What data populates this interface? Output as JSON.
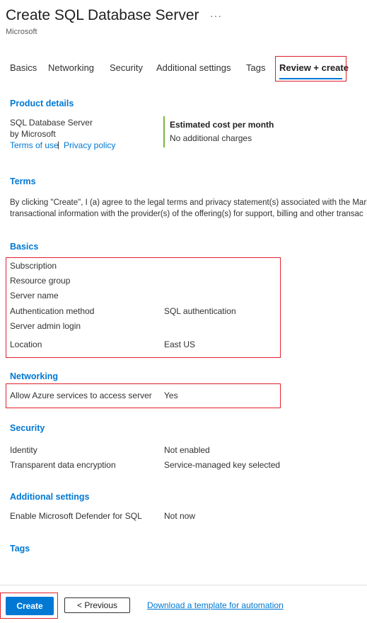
{
  "header": {
    "title": "Create SQL Database Server",
    "more_label": "···",
    "publisher": "Microsoft"
  },
  "tabs": [
    {
      "label": "Basics",
      "active": false
    },
    {
      "label": "Networking",
      "active": false
    },
    {
      "label": "Security",
      "active": false
    },
    {
      "label": "Additional settings",
      "active": false
    },
    {
      "label": "Tags",
      "active": false
    },
    {
      "label": "Review + create",
      "active": true
    }
  ],
  "product_details": {
    "heading": "Product details",
    "name": "SQL Database Server",
    "by": "by Microsoft",
    "terms_link": "Terms of use",
    "separator": "|",
    "privacy_link": "Privacy policy",
    "cost_heading": "Estimated cost per month",
    "cost_value": "No additional charges"
  },
  "terms": {
    "heading": "Terms",
    "line1": "By clicking \"Create\", I (a) agree to the legal terms and privacy statement(s) associated with the Marke",
    "line2": "transactional information with the provider(s) of the offering(s) for support, billing and other transac"
  },
  "basics": {
    "heading": "Basics",
    "rows": [
      {
        "label": "Subscription",
        "value": ""
      },
      {
        "label": "Resource group",
        "value": ""
      },
      {
        "label": "Server name",
        "value": ""
      },
      {
        "label": "Authentication method",
        "value": "SQL authentication"
      },
      {
        "label": "Server admin login",
        "value": ""
      },
      {
        "label": "Location",
        "value": "East US"
      }
    ]
  },
  "networking": {
    "heading": "Networking",
    "rows": [
      {
        "label": "Allow Azure services to access server",
        "value": "Yes"
      }
    ]
  },
  "security": {
    "heading": "Security",
    "rows": [
      {
        "label": "Identity",
        "value": "Not enabled"
      },
      {
        "label": "Transparent data encryption",
        "value": "Service-managed key selected"
      }
    ]
  },
  "additional": {
    "heading": "Additional settings",
    "rows": [
      {
        "label": "Enable Microsoft Defender for SQL",
        "value": "Not now"
      }
    ]
  },
  "tags": {
    "heading": "Tags"
  },
  "footer": {
    "create_label": "Create",
    "previous_label": "< Previous",
    "download_label": "Download a template for automation"
  },
  "colors": {
    "accent": "#0078d4",
    "highlight_box": "#e0212b",
    "cost_bar": "#78b73e"
  }
}
